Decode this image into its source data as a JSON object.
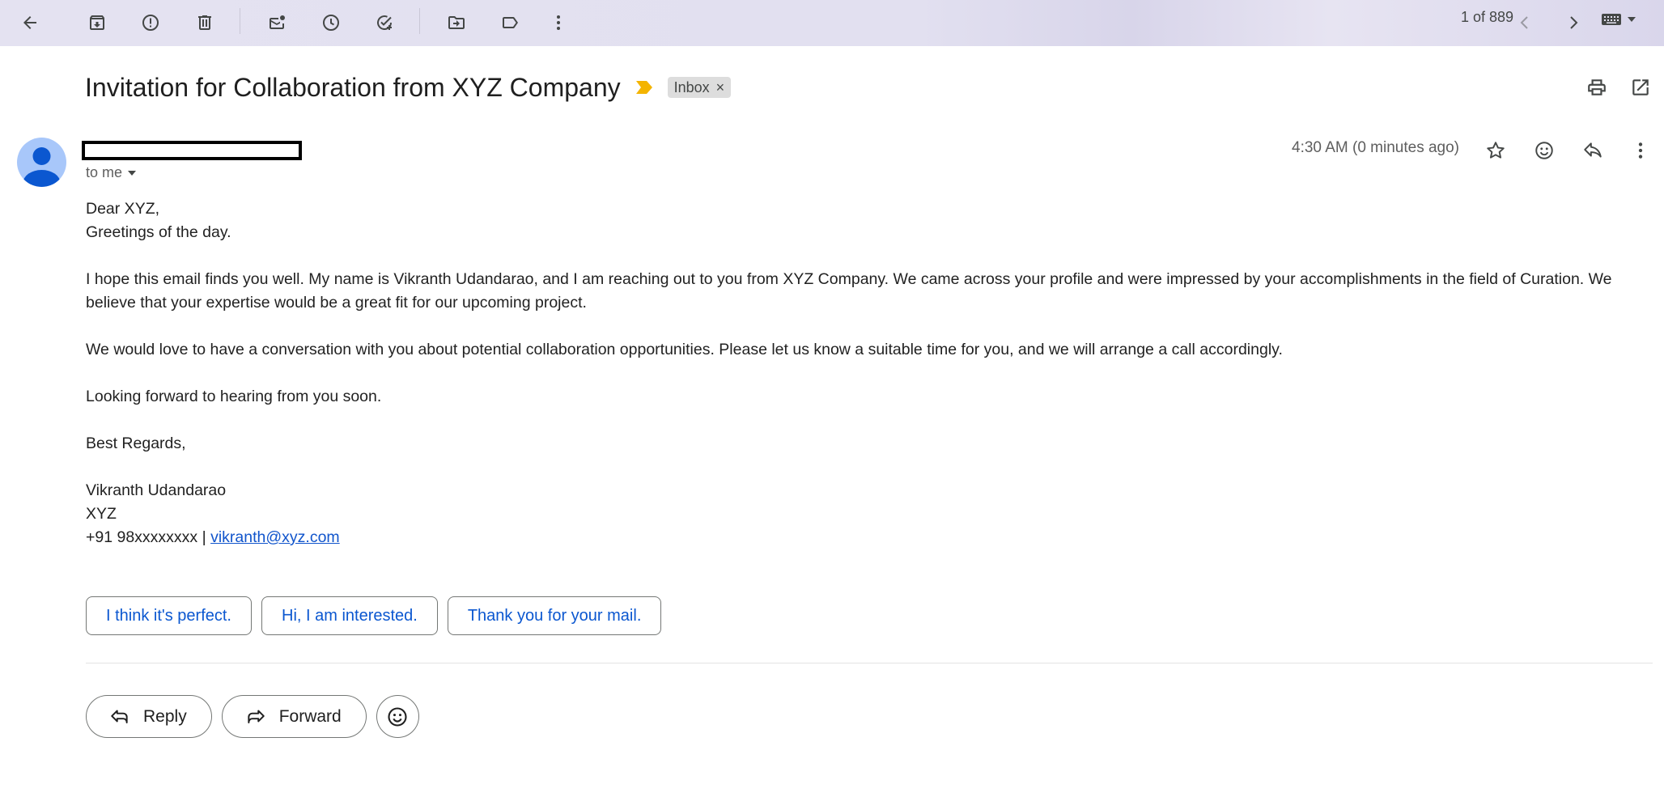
{
  "toolbar": {
    "icons": [
      "back-arrow-icon",
      "archive-icon",
      "report-spam-icon",
      "delete-icon",
      "mark-unread-icon",
      "snooze-icon",
      "add-task-icon",
      "move-to-icon",
      "label-icon",
      "more-vert-icon"
    ],
    "counter": "1 of 889",
    "nav_prev": "newer-chevron-icon",
    "nav_next": "older-chevron-icon",
    "input_tools": "keyboard-icon"
  },
  "email": {
    "subject": "Invitation for Collaboration from XYZ Company",
    "label": "Inbox",
    "label_remove": "×",
    "recipient": "to me",
    "timestamp": "4:30 AM (0 minutes ago)",
    "body": {
      "greeting": "Dear XYZ,",
      "greeting2": "Greetings of the day.",
      "para1": "I hope this email finds you well. My name is Vikranth Udandarao, and I am reaching out to you from XYZ Company. We came across your profile and were impressed by your accomplishments in the field of Curation. We believe that your expertise would be a great fit for our upcoming project.",
      "para2": "We would love to have a conversation with you about potential collaboration opportunities. Please let us know a suitable time for you, and we will arrange a call accordingly.",
      "para3": "Looking forward to hearing from you soon.",
      "signoff": "Best Regards,",
      "sig_name": "Vikranth Udandarao",
      "sig_company": "XYZ",
      "sig_phone": "+91 98xxxxxxxx | ",
      "sig_email": "vikranth@xyz.com"
    }
  },
  "smart_replies": [
    "I think it's perfect.",
    "Hi, I am interested.",
    "Thank you for your mail."
  ],
  "actions": {
    "reply": "Reply",
    "forward": "Forward"
  },
  "colors": {
    "link": "#1155cc",
    "smart_reply_text": "#0b57d0",
    "important_marker": "#f4b400",
    "avatar_bg": "#a8c7fa",
    "avatar_fg": "#0b57d0"
  }
}
